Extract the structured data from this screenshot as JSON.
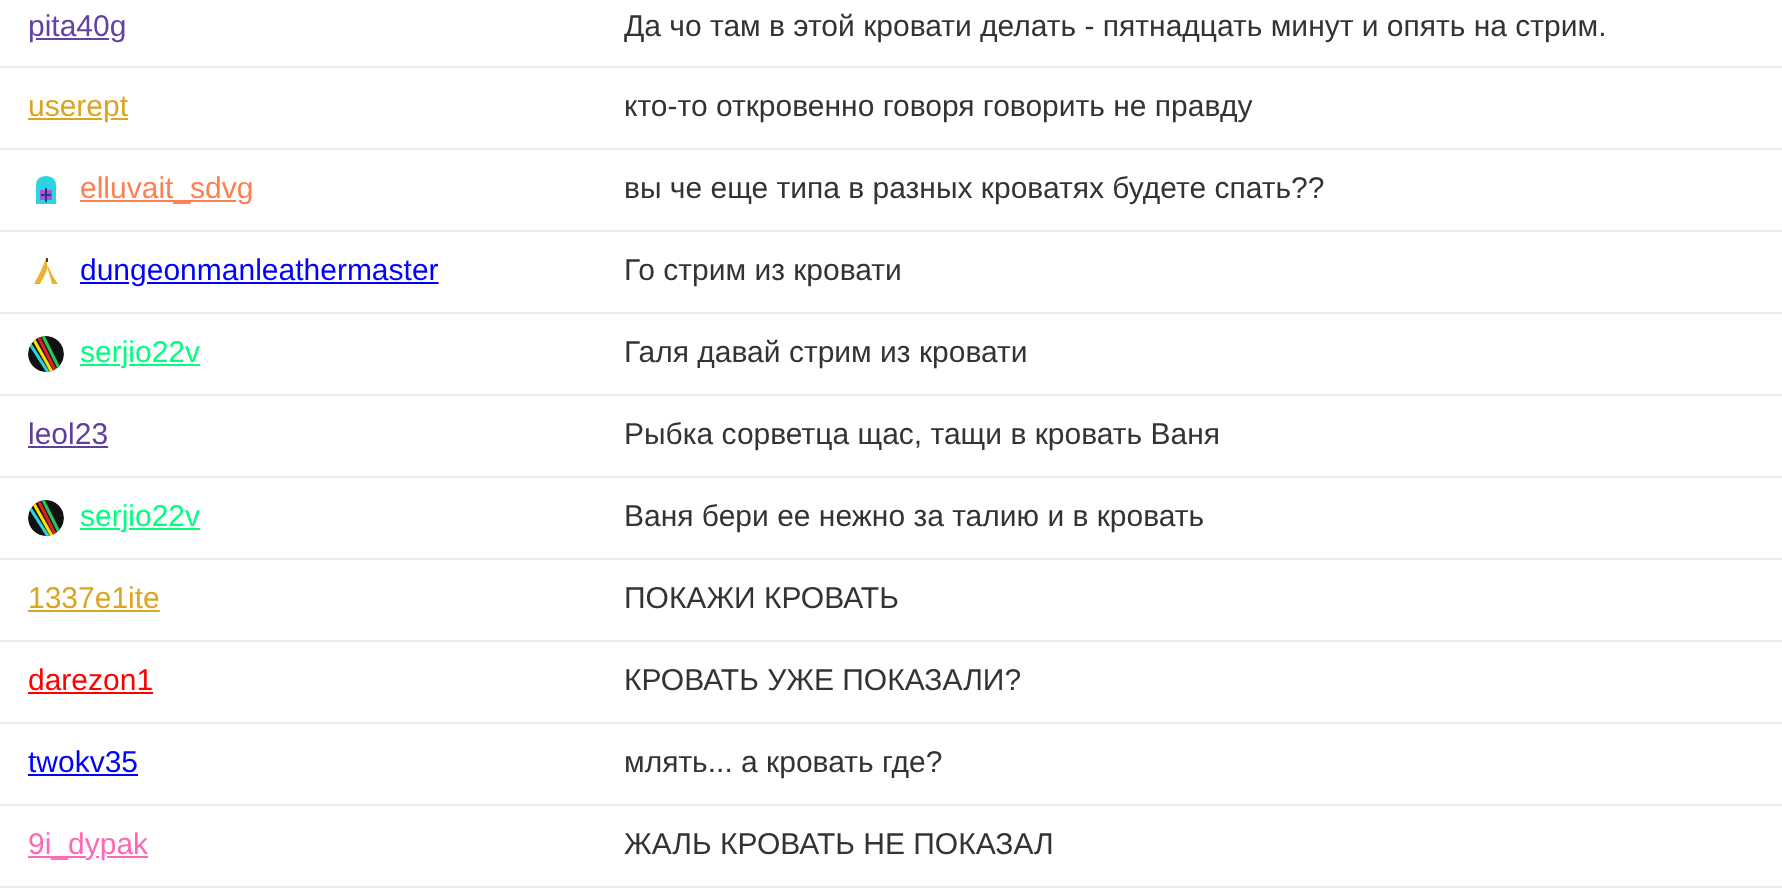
{
  "messages": [
    {
      "user": "pita40g",
      "color": "#6441a5",
      "message": "Да чо там в этой кровати делать - пятнадцать минут и опять на стрим."
    },
    {
      "user": "userept",
      "color": "#daa520",
      "message": "кто-то откровенно говоря говорить не правду"
    },
    {
      "user": "elluvait_sdvg",
      "color": "#ff7f50",
      "badge": {
        "kind": "hoodie"
      },
      "message": "вы че еще типа в разных кроватях будете спать??"
    },
    {
      "user": "dungeonmanleathermaster",
      "color": "#0000ff",
      "badge": {
        "kind": "banana"
      },
      "message": "Го стрим из кровати"
    },
    {
      "user": "serjio22v",
      "color": "#00ff7f",
      "badge": {
        "kind": "stripes"
      },
      "message": "Галя давай стрим из кровати"
    },
    {
      "user": "leol23",
      "color": "#5f3e9e",
      "message": "Рыбка сорветца щас, тащи в кровать Ваня"
    },
    {
      "user": "serjio22v",
      "color": "#00ff7f",
      "badge": {
        "kind": "stripes"
      },
      "message": "Ваня бери ее нежно за талию и в кровать"
    },
    {
      "user": "1337e1ite",
      "color": "#daa520",
      "message": "ПОКАЖИ КРОВАТЬ"
    },
    {
      "user": "darezon1",
      "color": "#ff0000",
      "message": "КРОВАТЬ УЖЕ ПОКАЗАЛИ?"
    },
    {
      "user": "twokv35",
      "color": "#0000ff",
      "message": "млять... а кровать где?"
    },
    {
      "user": "9i_dypak",
      "color": "#ff69b4",
      "message": "ЖАЛЬ КРОВАТЬ НЕ ПОКАЗАЛ"
    }
  ]
}
